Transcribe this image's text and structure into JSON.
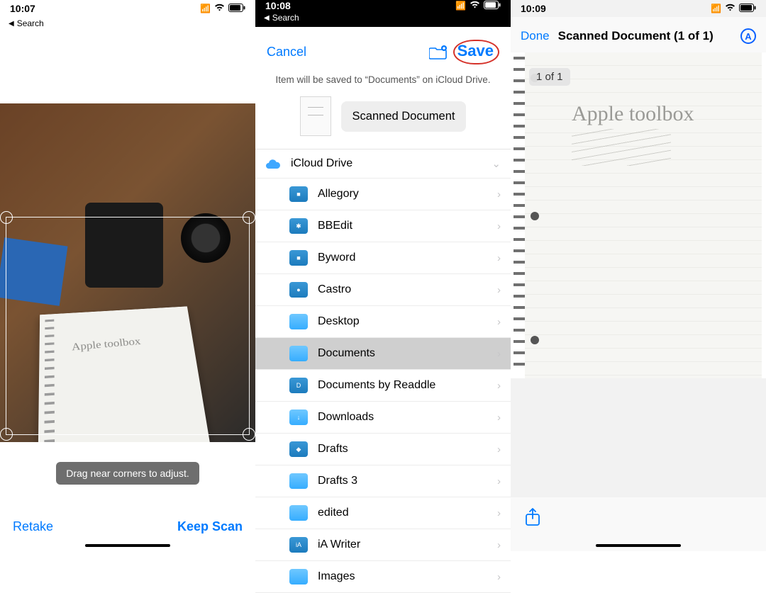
{
  "screen1": {
    "status_time": "10:07",
    "back_label": "Search",
    "handwriting": "Apple toolbox",
    "hint": "Drag near corners to adjust.",
    "retake": "Retake",
    "keep": "Keep Scan"
  },
  "screen2": {
    "status_time": "10:08",
    "back_label": "Search",
    "cancel": "Cancel",
    "save": "Save",
    "subtitle": "Item will be saved to “Documents” on iCloud Drive.",
    "doc_name": "Scanned Document",
    "root_label": "iCloud Drive",
    "folders": [
      {
        "label": "Allegory",
        "style": "fdark",
        "glyph": "■"
      },
      {
        "label": "BBEdit",
        "style": "fdark",
        "glyph": "✱"
      },
      {
        "label": "Byword",
        "style": "fdark",
        "glyph": "■"
      },
      {
        "label": "Castro",
        "style": "fdark",
        "glyph": "●"
      },
      {
        "label": "Desktop",
        "style": "fblue",
        "glyph": ""
      },
      {
        "label": "Documents",
        "style": "fblue",
        "glyph": "",
        "selected": true
      },
      {
        "label": "Documents by Readdle",
        "style": "fdark",
        "glyph": "D"
      },
      {
        "label": "Downloads",
        "style": "fblue",
        "glyph": "↓"
      },
      {
        "label": "Drafts",
        "style": "fdark",
        "glyph": "◆"
      },
      {
        "label": "Drafts 3",
        "style": "fblue",
        "glyph": ""
      },
      {
        "label": "edited",
        "style": "fblue",
        "glyph": ""
      },
      {
        "label": "iA Writer",
        "style": "fdark",
        "glyph": "iA"
      },
      {
        "label": "Images",
        "style": "fblue",
        "glyph": ""
      }
    ]
  },
  "screen3": {
    "status_time": "10:09",
    "done": "Done",
    "title": "Scanned Document (1 of 1)",
    "page_badge": "1 of 1",
    "handwriting": "Apple toolbox"
  }
}
